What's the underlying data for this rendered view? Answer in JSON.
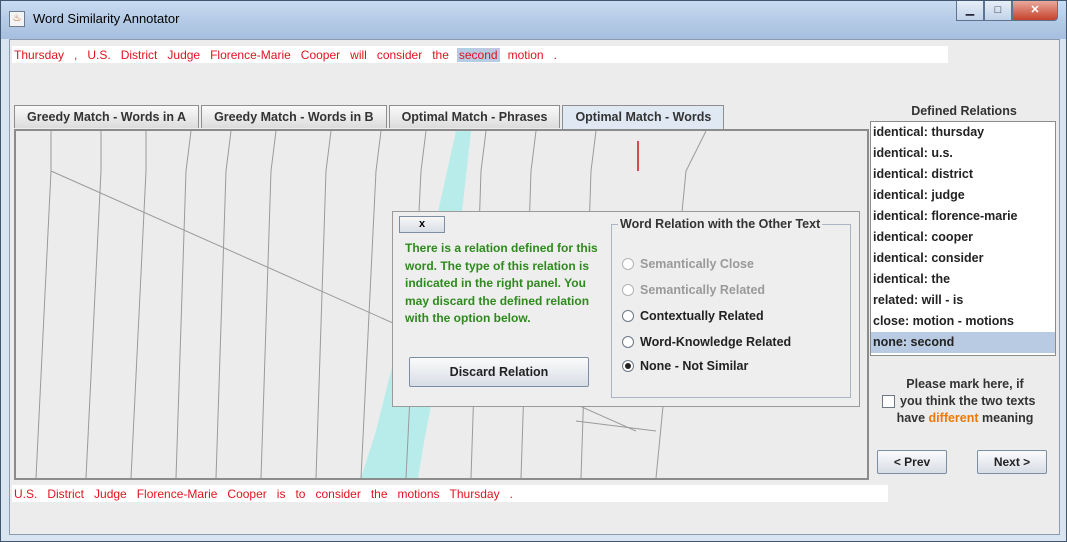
{
  "window": {
    "title": "Word Similarity Annotator",
    "buttons": [
      "minimize",
      "maximize",
      "close"
    ]
  },
  "text_a": {
    "tokens": [
      "Thursday",
      ",",
      "U.S.",
      "District",
      "Judge",
      "Florence-Marie",
      "Cooper",
      "will",
      "consider",
      "the",
      "second",
      "motion",
      "."
    ],
    "selected_index": 10
  },
  "text_b": {
    "tokens": [
      "U.S.",
      "District",
      "Judge",
      "Florence-Marie",
      "Cooper",
      "is",
      "to",
      "consider",
      "the",
      "motions",
      "Thursday",
      "."
    ]
  },
  "tabs": [
    {
      "label": "Greedy Match - Words in A",
      "active": false
    },
    {
      "label": "Greedy Match - Words in B",
      "active": false
    },
    {
      "label": "Optimal Match - Phrases",
      "active": false
    },
    {
      "label": "Optimal Match - Words",
      "active": true
    }
  ],
  "dialog": {
    "close_label": "x",
    "message": "There is a relation defined for this word. The type of this relation is indicated in the right panel. You may discard the defined relation with the option below.",
    "discard_label": "Discard Relation",
    "group_title": "Word Relation with the Other Text",
    "options": [
      {
        "label": "Semantically Close",
        "enabled": false,
        "checked": false
      },
      {
        "label": "Semantically Related",
        "enabled": false,
        "checked": false
      },
      {
        "label": "Contextually Related",
        "enabled": true,
        "checked": false
      },
      {
        "label": "Word-Knowledge Related",
        "enabled": true,
        "checked": false
      },
      {
        "label": "None - Not Similar",
        "enabled": true,
        "checked": true
      }
    ]
  },
  "relations": {
    "title": "Defined Relations",
    "items": [
      "identical: thursday",
      "identical: u.s.",
      "identical: district",
      "identical: judge",
      "identical: florence-marie",
      "identical: cooper",
      "identical: consider",
      "identical: the",
      "related: will - is",
      "close: motion - motions",
      "none: second"
    ],
    "selected_index": 10
  },
  "mark": {
    "line1": "Please mark here, if",
    "line2": "you think the two texts",
    "line3_pre": "have ",
    "line3_highlight": "different",
    "line3_post": " meaning"
  },
  "nav": {
    "prev_label": "< Prev",
    "next_label": "Next >"
  },
  "colors": {
    "token_text": "#e0141e",
    "selection": "#b9cbe2",
    "dialog_message": "#2e8a1d",
    "highlight_word": "#f07800",
    "match_band": "#b8ecea"
  }
}
